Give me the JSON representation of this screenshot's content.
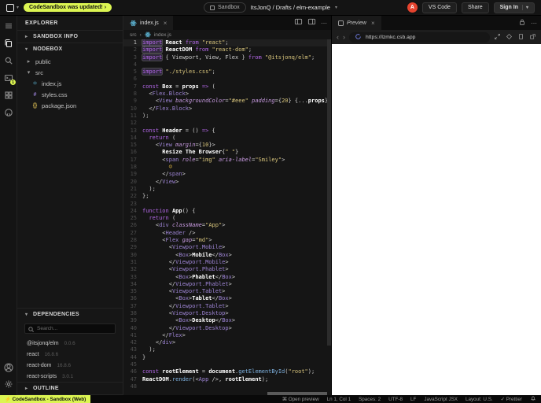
{
  "topbar": {
    "update_banner": "CodeSandbox was updated! ›",
    "sandbox_label": "Sandbox",
    "project_path": "ItsJonQ / Drafts / elm-example",
    "avatar_letter": "A",
    "vscode_button": "VS Code",
    "share_button": "Share",
    "signin_button": "Sign In"
  },
  "activity_bar": {
    "terminal_badge": "1"
  },
  "sidebar": {
    "title": "EXPLORER",
    "sandbox_info_label": "SANDBOX INFO",
    "workspace_label": "NODEBOX",
    "files": [
      {
        "label": "public",
        "icon": "chevron-right",
        "indent": 0
      },
      {
        "label": "src",
        "icon": "chevron-down",
        "indent": 0
      },
      {
        "label": "index.js",
        "icon": "react",
        "indent": 1
      },
      {
        "label": "styles.css",
        "icon": "css",
        "indent": 1
      },
      {
        "label": "package.json",
        "icon": "json",
        "indent": 1
      }
    ],
    "dependencies_label": "DEPENDENCIES",
    "search_placeholder": "Search...",
    "dependencies": [
      {
        "name": "@itsjonq/elm",
        "version": "0.0.6"
      },
      {
        "name": "react",
        "version": "16.8.6"
      },
      {
        "name": "react-dom",
        "version": "16.8.6"
      },
      {
        "name": "react-scripts",
        "version": "3.0.1"
      }
    ],
    "outline_label": "OUTLINE"
  },
  "editor": {
    "tab_label": "index.js",
    "breadcrumb": [
      "src",
      "index.js"
    ],
    "code_lines": [
      "import React from \"react\";",
      "import ReactDOM from \"react-dom\";",
      "import { Viewport, View, Flex } from \"@itsjonq/elm\";",
      "",
      "import \"./styles.css\";",
      "",
      "const Box = props => (",
      "  <Flex.Block>",
      "    <View backgroundColor=\"#eee\" padding={20} {...props} />",
      "  </Flex.Block>",
      ");",
      "",
      "const Header = () => {",
      "  return (",
      "    <View margin={10}>",
      "      Resize The Browser{\" \"}",
      "      <span role=\"img\" aria-label=\"Smiley\">",
      "        😀",
      "      </span>",
      "    </View>",
      "  );",
      "};",
      "",
      "function App() {",
      "  return (",
      "    <div className=\"App\">",
      "      <Header />",
      "      <Flex gap=\"md\">",
      "        <Viewport.Mobile>",
      "          <Box>Mobile</Box>",
      "        </Viewport.Mobile>",
      "        <Viewport.Phablet>",
      "          <Box>Phablet</Box>",
      "        </Viewport.Phablet>",
      "        <Viewport.Tablet>",
      "          <Box>Tablet</Box>",
      "        </Viewport.Tablet>",
      "        <Viewport.Desktop>",
      "          <Box>Desktop</Box>",
      "        </Viewport.Desktop>",
      "      </Flex>",
      "    </div>",
      "  );",
      "}",
      "",
      "const rootElement = document.getElementById(\"root\");",
      "ReactDOM.render(<App />, rootElement);",
      ""
    ]
  },
  "preview": {
    "tab_label": "Preview",
    "url": "https://lzmkc.csb.app"
  },
  "statusbar": {
    "left_badge": "⚡ CodeSandbox - Sandbox (Web)",
    "items": [
      "⌘ Open preview",
      "Ln 1, Col 1",
      "Spaces: 2",
      "UTF-8",
      "LF",
      "JavaScript JSX",
      "Layout: U.S.",
      "✓ Prettier"
    ]
  }
}
